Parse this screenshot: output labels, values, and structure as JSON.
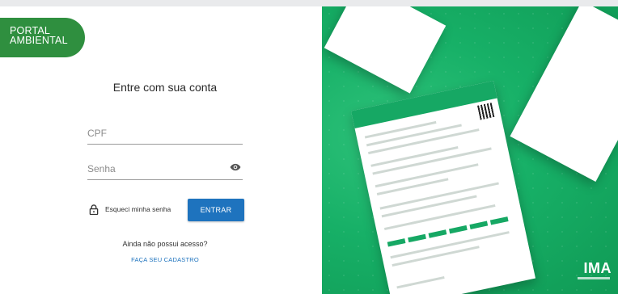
{
  "logo": {
    "line1": "PORTAL",
    "line2": "AMBIENTAL"
  },
  "login": {
    "title": "Entre com sua conta",
    "cpf_placeholder": "CPF",
    "senha_placeholder": "Senha",
    "forgot_label": "Esqueci minha senha",
    "submit_label": "ENTRAR",
    "no_access": "Ainda não possui acesso?",
    "signup_label": "FAÇA SEU CADASTRO"
  },
  "colors": {
    "brand_green": "#2f8f3f",
    "panel_green": "#17b067",
    "button_blue": "#1e73be"
  },
  "icons": {
    "password_toggle": "eye-icon",
    "forgot": "lock-icon"
  }
}
